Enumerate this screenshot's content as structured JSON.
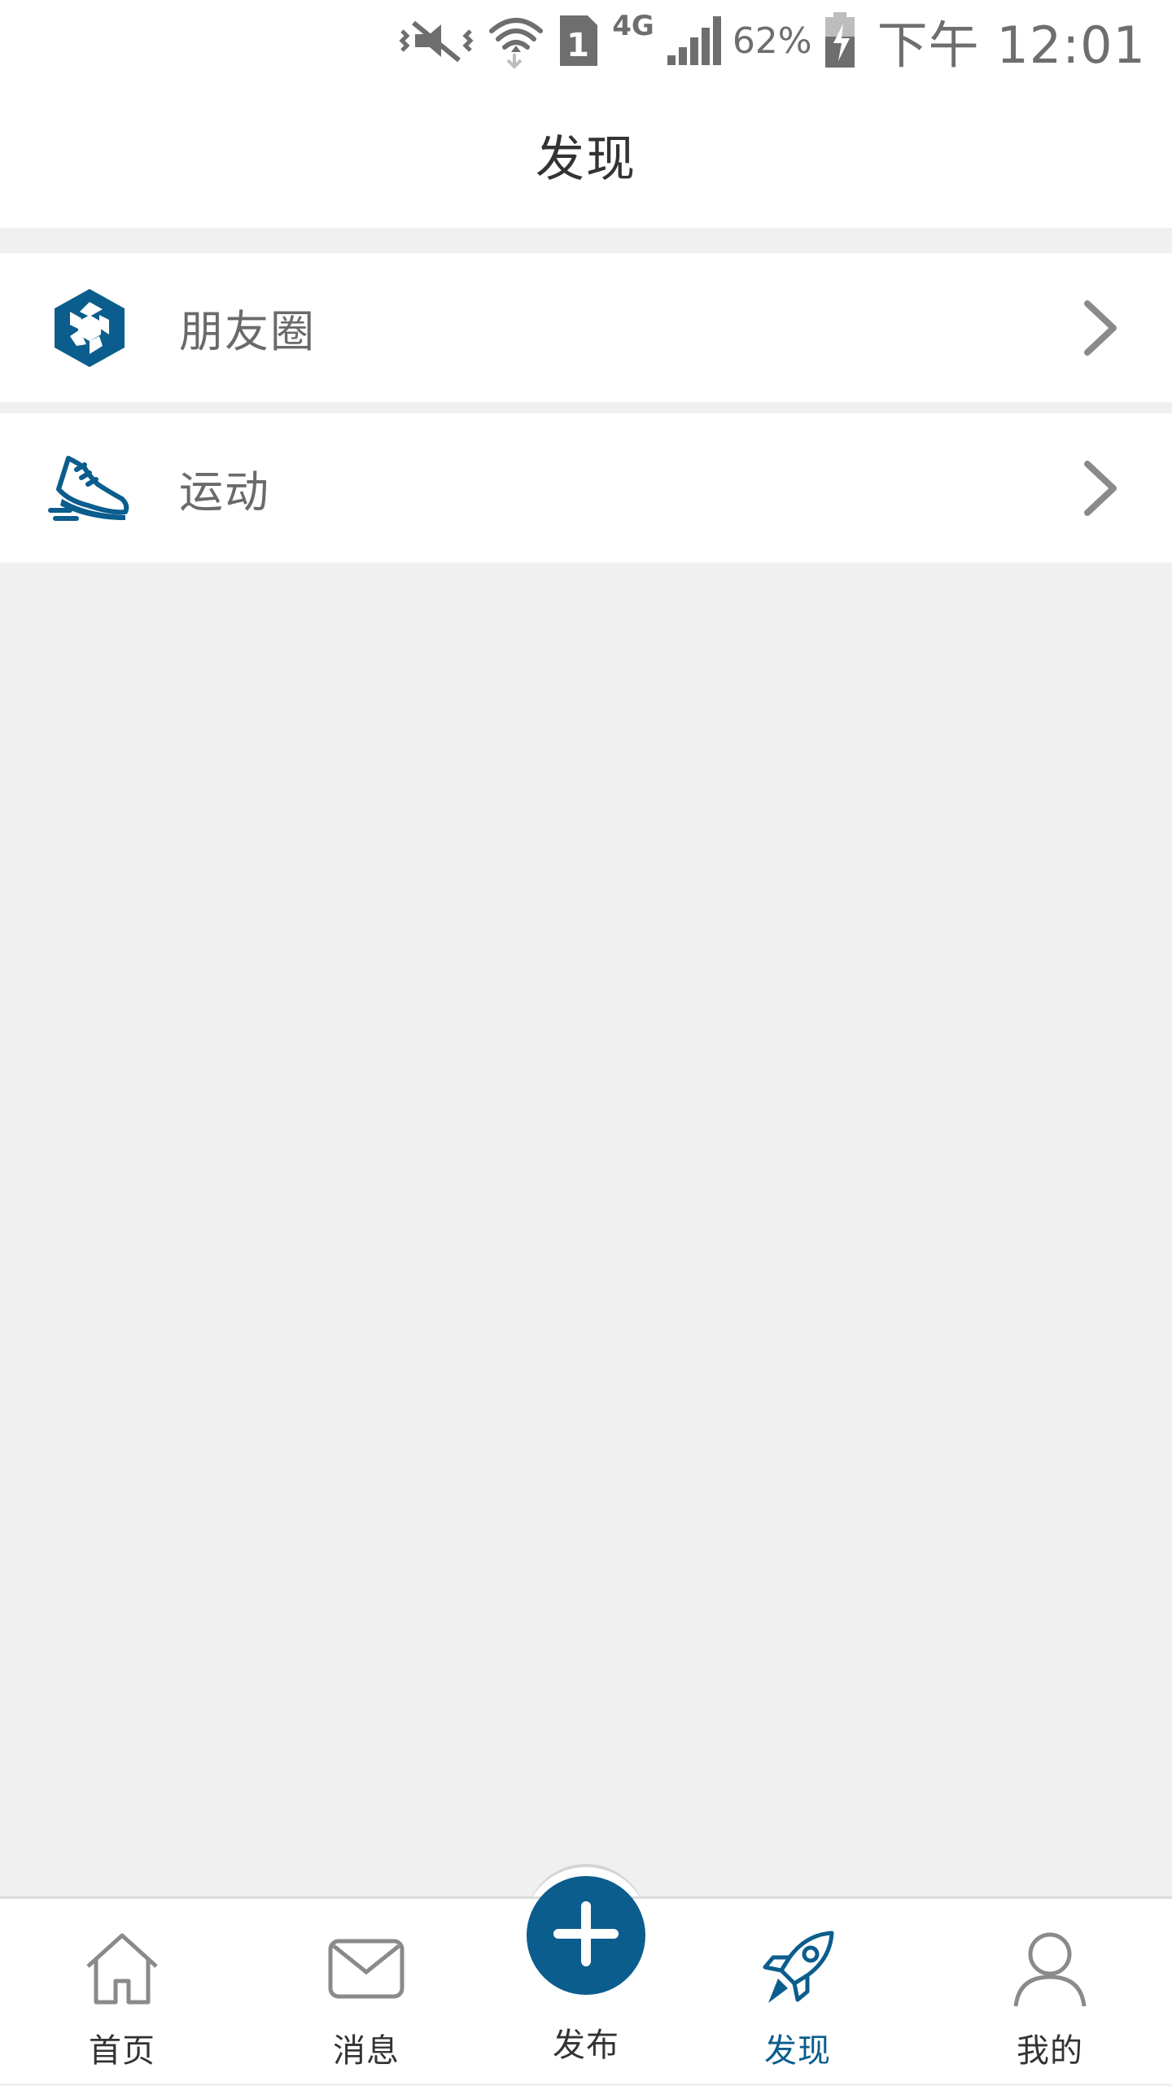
{
  "status_bar": {
    "network_type": "4G",
    "sim_slot": "1",
    "battery_percent": "62%",
    "time": "下午 12:01"
  },
  "header": {
    "title": "发现"
  },
  "list": {
    "items": [
      {
        "label": "朋友圈",
        "icon": "aperture-icon"
      },
      {
        "label": "运动",
        "icon": "sneaker-icon"
      }
    ]
  },
  "bottom_nav": {
    "items": [
      {
        "label": "首页",
        "icon": "home-icon"
      },
      {
        "label": "消息",
        "icon": "mail-icon"
      },
      {
        "label": "发布",
        "icon": "plus-icon"
      },
      {
        "label": "发现",
        "icon": "rocket-icon",
        "active": true
      },
      {
        "label": "我的",
        "icon": "user-icon"
      }
    ]
  },
  "colors": {
    "accent": "#0b5d8d",
    "background": "#f0f0f0",
    "surface": "#ffffff",
    "text_primary": "#333333",
    "text_secondary": "#6a6a6a",
    "icon_gray": "#8a8a8a"
  }
}
